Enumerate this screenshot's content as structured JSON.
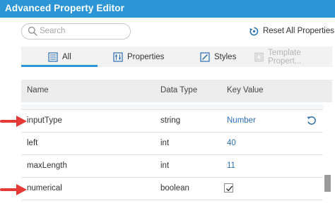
{
  "window": {
    "title": "Advanced Property Editor"
  },
  "search": {
    "placeholder": "Search"
  },
  "toolbar": {
    "reset_label": "Reset All Properties"
  },
  "tabs": [
    {
      "label": "All",
      "active": true,
      "icon": "list-icon"
    },
    {
      "label": "Properties",
      "active": false,
      "icon": "properties-icon"
    },
    {
      "label": "Styles",
      "active": false,
      "icon": "styles-icon"
    },
    {
      "label": "Template Propert...",
      "active": false,
      "disabled": true,
      "icon": "template-icon"
    }
  ],
  "table": {
    "columns": [
      "Name",
      "Data Type",
      "Key Value"
    ],
    "rows": [
      {
        "name": "inputType",
        "type": "string",
        "value": "Number",
        "has_reset": true,
        "highlighted": true
      },
      {
        "name": "left",
        "type": "int",
        "value": "40"
      },
      {
        "name": "maxLength",
        "type": "int",
        "value": "11"
      },
      {
        "name": "numerical",
        "type": "boolean",
        "value": "",
        "checked": true,
        "highlighted": true
      }
    ]
  },
  "colors": {
    "accent": "#2b95d6",
    "annotation_arrow": "#e53935",
    "link_value": "#2b6fb3"
  }
}
